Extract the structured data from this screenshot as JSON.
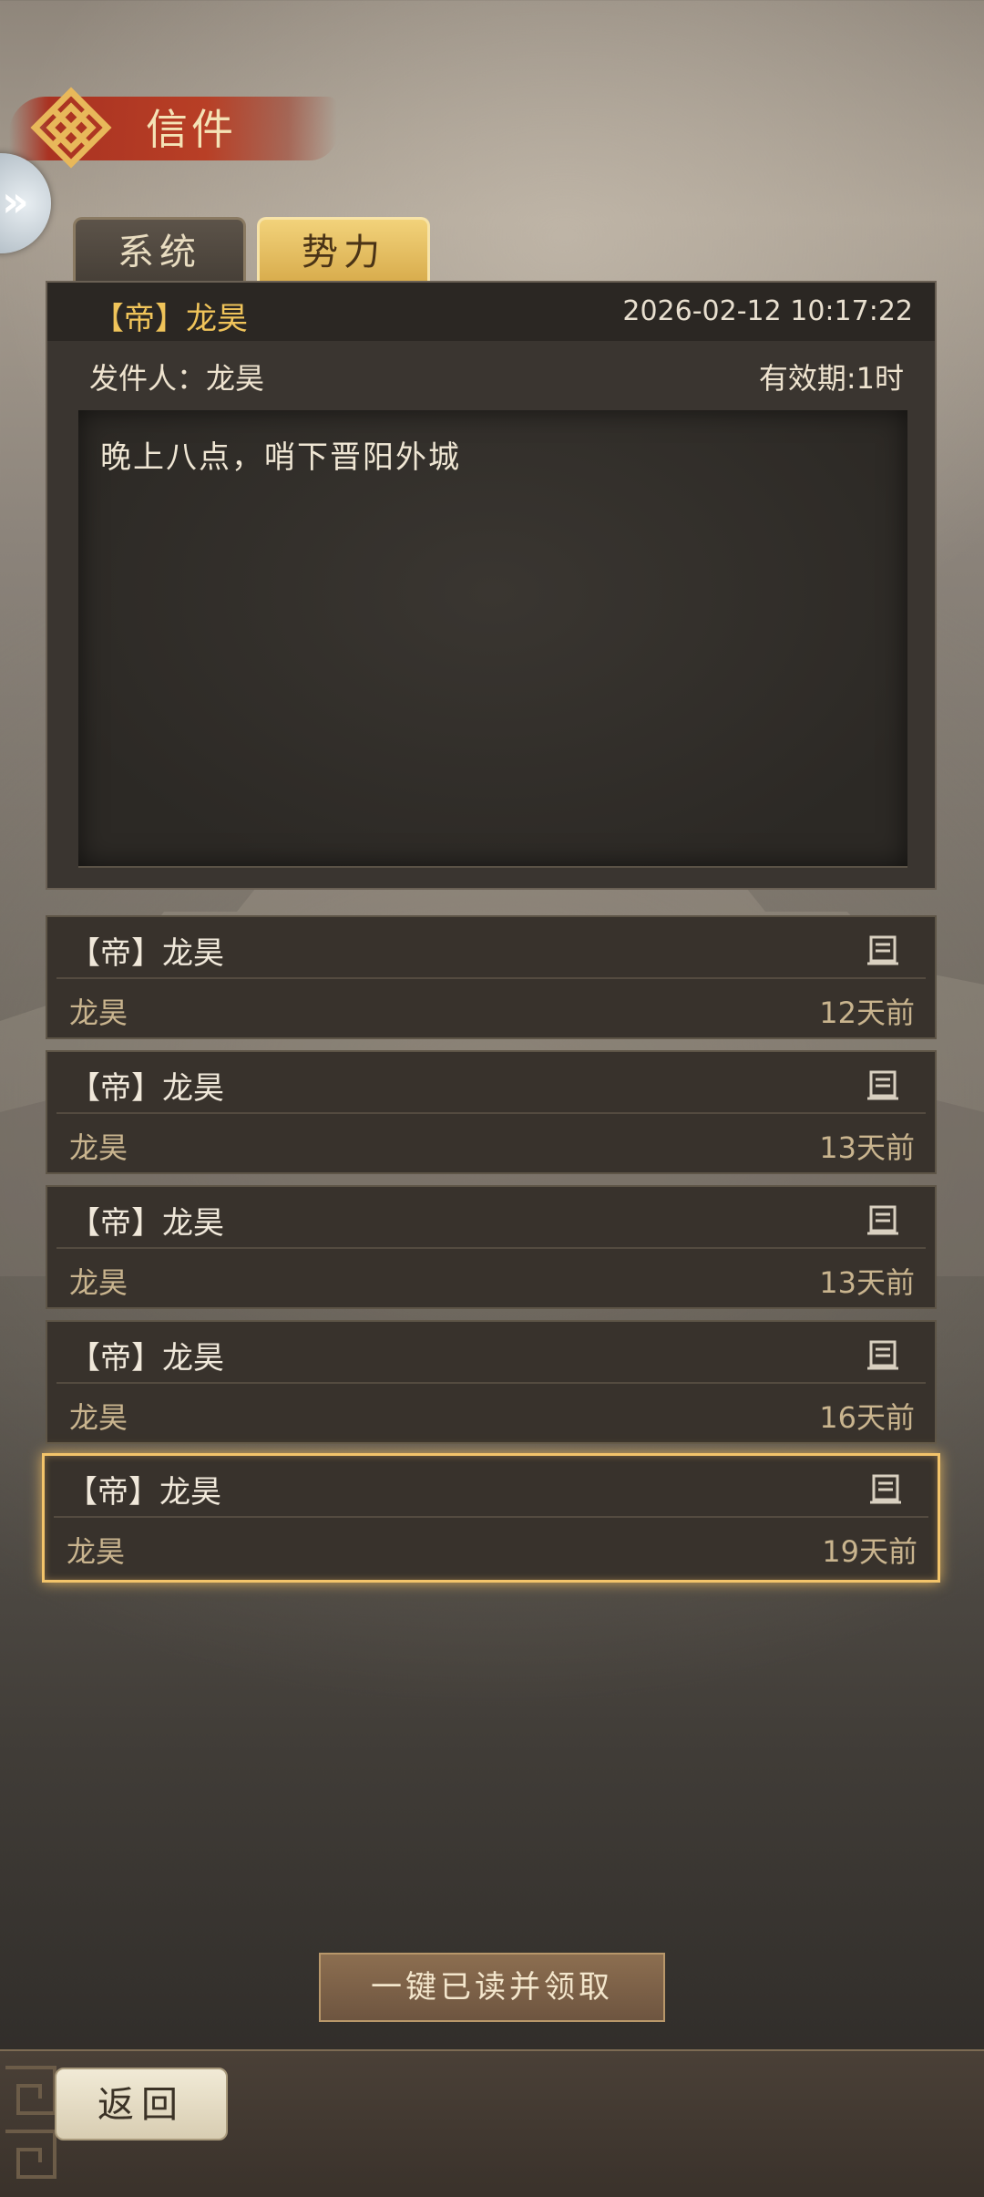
{
  "header": {
    "title": "信件"
  },
  "tabs": [
    {
      "label": "系统",
      "active": false
    },
    {
      "label": "势力",
      "active": true
    }
  ],
  "detail": {
    "title": "【帝】龙昊",
    "timestamp": "2026-02-12 10:17:22",
    "sender": "发件人：龙昊",
    "validity": "有效期:1时",
    "body": "晚上八点，哨下晋阳外城"
  },
  "mails": [
    {
      "title": "【帝】龙昊",
      "sender": "龙昊",
      "age": "12天前",
      "icon": "letter-icon"
    },
    {
      "title": "【帝】龙昊",
      "sender": "龙昊",
      "age": "13天前",
      "icon": "letter-icon"
    },
    {
      "title": "【帝】龙昊",
      "sender": "龙昊",
      "age": "13天前",
      "icon": "letter-icon"
    },
    {
      "title": "【帝】龙昊",
      "sender": "龙昊",
      "age": "16天前",
      "icon": "letter-icon"
    },
    {
      "title": "【帝】龙昊",
      "sender": "龙昊",
      "age": "19天前",
      "icon": "letter-icon",
      "selected": true
    }
  ],
  "actions": {
    "claim_all": "一键已读并领取",
    "back": "返回"
  },
  "colors": {
    "accent_gold": "#f0c45a",
    "selected_border": "#f3c46a",
    "tab_active": "#e2b95a"
  }
}
